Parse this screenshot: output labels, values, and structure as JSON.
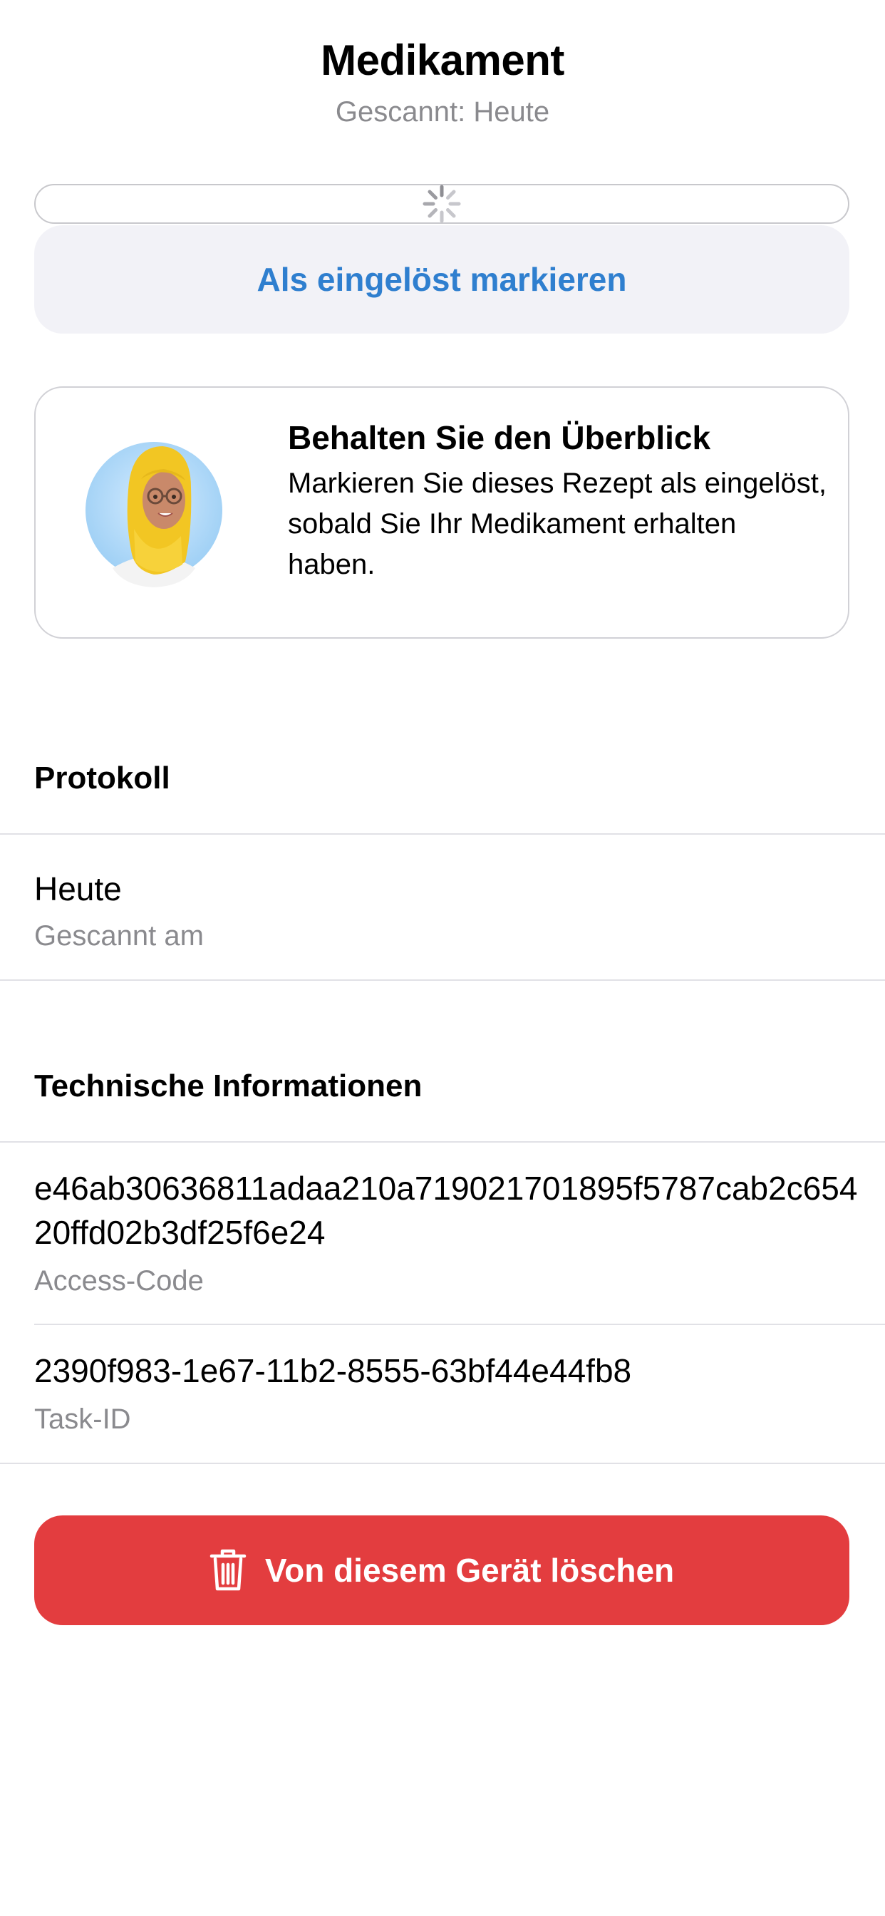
{
  "header": {
    "title": "Medikament",
    "subtitle": "Gescannt: Heute"
  },
  "loading": {
    "icon": "spinner-icon"
  },
  "actions": {
    "mark_redeemed_label": "Als eingelöst markieren",
    "delete_label": "Von diesem Gerät löschen",
    "delete_icon": "trash-icon"
  },
  "info_card": {
    "title": "Behalten Sie den Überblick",
    "body": "Markieren Sie dieses Rezept als eingelöst, sobald Sie Ihr Medikament erhalten haben."
  },
  "protocol": {
    "heading": "Protokoll",
    "entries": [
      {
        "value": "Heute",
        "label": "Gescannt am"
      }
    ]
  },
  "technical": {
    "heading": "Technische Informationen",
    "rows": [
      {
        "value": "e46ab30636811adaa210a719021701895f5787cab2c65420ffd02b3df25f6e24",
        "label": "Access-Code"
      },
      {
        "value": "2390f983-1e67-11b2-8555-63bf44e44fb8",
        "label": "Task-ID"
      }
    ]
  },
  "colors": {
    "accent_blue": "#2f7fcf",
    "destructive_red": "#e33d3f",
    "secondary_text": "#8a8a8e",
    "button_background": "#f2f2f7",
    "divider": "#e1e1e6"
  }
}
